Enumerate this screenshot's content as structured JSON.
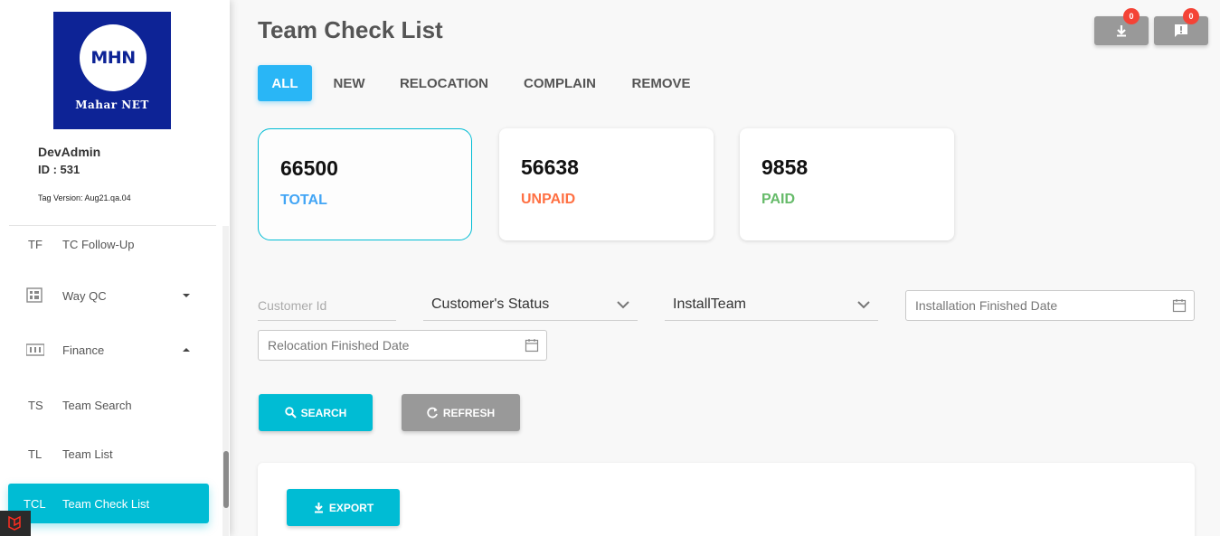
{
  "brand": {
    "abbr": "MHN",
    "name": "Mahar NET"
  },
  "user": {
    "name": "DevAdmin",
    "id": "ID : 531",
    "tag_version": "Tag Version: Aug21.qa.04"
  },
  "sidebar": {
    "items": [
      {
        "abbr": "TF",
        "label": "TC Follow-Up"
      },
      {
        "icon": "grid-icon",
        "label": "Way QC",
        "caret": "down"
      },
      {
        "icon": "finance-icon",
        "label": "Finance",
        "caret": "up"
      },
      {
        "abbr": "TS",
        "label": "Team Search"
      },
      {
        "abbr": "TL",
        "label": "Team List"
      },
      {
        "abbr": "TCL",
        "label": "Team Check List",
        "active": true
      }
    ]
  },
  "header": {
    "title": "Team Check List",
    "download_badge": "0",
    "notification_badge": "0"
  },
  "tabs": [
    "ALL",
    "NEW",
    "RELOCATION",
    "COMPLAIN",
    "REMOVE"
  ],
  "stats": [
    {
      "value": "66500",
      "label": "TOTAL",
      "color": "#42a5f5"
    },
    {
      "value": "56638",
      "label": "UNPAID",
      "color": "#ff7043"
    },
    {
      "value": "9858",
      "label": "PAID",
      "color": "#66bb6a"
    }
  ],
  "filters": {
    "customer_id_placeholder": "Customer Id",
    "customer_status": "Customer's Status",
    "install_team": "InstallTeam",
    "installation_date_placeholder": "Installation Finished Date",
    "relocation_date_placeholder": "Relocation Finished Date"
  },
  "actions": {
    "search": "SEARCH",
    "refresh": "REFRESH",
    "export": "EXPORT"
  }
}
